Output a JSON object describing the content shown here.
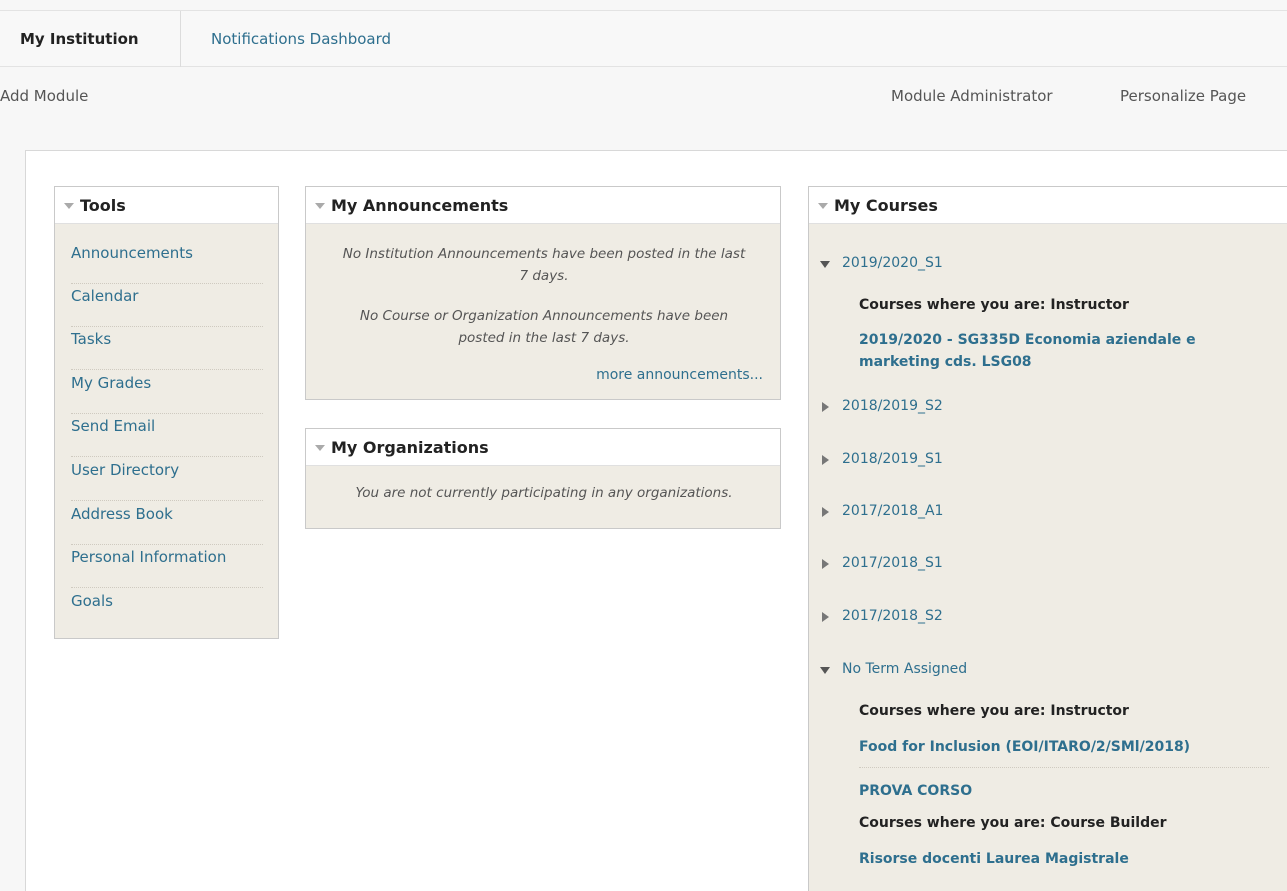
{
  "tabs": {
    "active": "My Institution",
    "other": "Notifications Dashboard"
  },
  "actions": {
    "add_module": "Add Module",
    "module_administrator": "Module Administrator",
    "personalize_page": "Personalize Page"
  },
  "tools": {
    "title": "Tools",
    "items": [
      "Announcements",
      "Calendar",
      "Tasks",
      "My Grades",
      "Send Email",
      "User Directory",
      "Address Book",
      "Personal Information",
      "Goals"
    ]
  },
  "announcements": {
    "title": "My Announcements",
    "institution_line1": "No Institution Announcements have been posted in the last",
    "institution_line2": "7 days.",
    "course_line1": "No Course or Organization Announcements have been",
    "course_line2": "posted in the last 7 days.",
    "more": "more announcements..."
  },
  "organizations": {
    "title": "My Organizations",
    "empty": "You are not currently participating in any organizations."
  },
  "courses": {
    "title": "My Courses",
    "terms": [
      {
        "name": "2019/2020_S1",
        "expanded": true
      },
      {
        "name": "2018/2019_S2",
        "expanded": false
      },
      {
        "name": "2018/2019_S1",
        "expanded": false
      },
      {
        "name": "2017/2018_A1",
        "expanded": false
      },
      {
        "name": "2017/2018_S1",
        "expanded": false
      },
      {
        "name": "2017/2018_S2",
        "expanded": false
      },
      {
        "name": "No Term Assigned",
        "expanded": true
      }
    ],
    "role_instructor": "Courses where you are: Instructor",
    "role_builder": "Courses where you are: Course Builder",
    "course_2019_line1": "2019/2020 - SG335D Economia aziendale e",
    "course_2019_line2": "marketing cds. LSG08",
    "course_food": "Food for Inclusion (EOI/ITARO/2/SMl/2018)",
    "course_prova": "PROVA CORSO",
    "course_risorse": "Risorse docenti Laurea Magistrale"
  }
}
